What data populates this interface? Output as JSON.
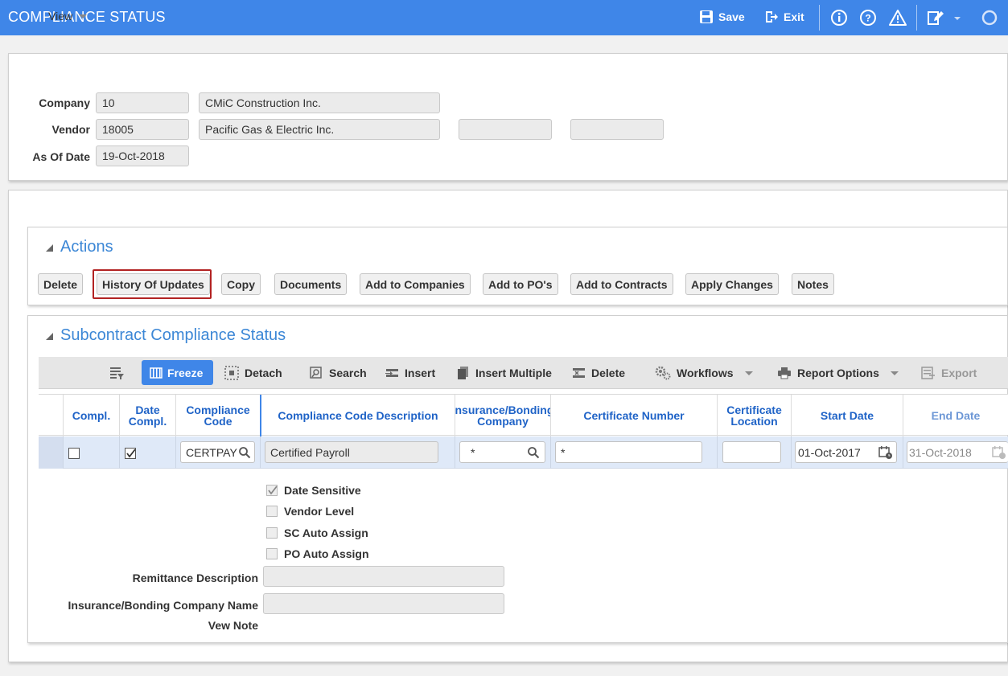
{
  "window": {
    "title": "COMPLIANCE STATUS"
  },
  "titlebar": {
    "save_label": "Save",
    "exit_label": "Exit"
  },
  "header": {
    "company_label": "Company",
    "company_code": "10",
    "company_name": "CMiC Construction Inc.",
    "vendor_label": "Vendor",
    "vendor_code": "18005",
    "vendor_name": "Pacific Gas & Electric Inc.",
    "vendor_extra1": "",
    "vendor_extra2": "",
    "as_of_date_label": "As Of Date",
    "as_of_date": "19-Oct-2018"
  },
  "actions": {
    "title": "Actions",
    "buttons": [
      "Delete",
      "History Of Updates",
      "Copy",
      "Documents",
      "Add to Companies",
      "Add to PO's",
      "Add to Contracts",
      "Apply Changes",
      "Notes"
    ],
    "highlighted": "History Of Updates"
  },
  "compliance": {
    "title": "Subcontract Compliance Status",
    "toolbar": {
      "view": "View",
      "freeze": "Freeze",
      "detach": "Detach",
      "search": "Search",
      "insert": "Insert",
      "insert_multiple": "Insert Multiple",
      "delete": "Delete",
      "workflows": "Workflows",
      "report_options": "Report Options",
      "export": "Export"
    },
    "columns": {
      "compl": "Compl.",
      "date_compl_1": "Date",
      "date_compl_2": "Compl.",
      "code_1": "Compliance",
      "code_2": "Code",
      "description": "Compliance Code Description",
      "insurance_1": "Insurance/Bonding",
      "insurance_2": "Company",
      "certificate_number": "Certificate Number",
      "cert_loc_1": "Certificate",
      "cert_loc_2": "Location",
      "start_date": "Start Date",
      "end_date": "End Date"
    },
    "row": {
      "compl": false,
      "date_compl": true,
      "code": "CERTPAY",
      "description": "Certified Payroll",
      "insurance": "*",
      "certificate_number": "*",
      "certificate_location": "",
      "start_date": "01-Oct-2017",
      "end_date": "31-Oct-2018"
    },
    "detail": {
      "date_sensitive_label": "Date Sensitive",
      "date_sensitive": true,
      "vendor_level_label": "Vendor Level",
      "vendor_level": false,
      "sc_auto_assign_label": "SC Auto Assign",
      "sc_auto_assign": false,
      "po_auto_assign_label": "PO Auto Assign",
      "po_auto_assign": false,
      "remittance_label": "Remittance Description",
      "remittance": "",
      "ins_bond_name_label": "Insurance/Bonding Company Name",
      "ins_bond_name": "",
      "vew_note_label": "Vew Note"
    }
  },
  "colors": {
    "accent": "#3f86e8",
    "section_title": "#3c87d6",
    "column_header": "#1f63c7",
    "row_selected": "#dfe9f8",
    "highlight_border": "#b22222"
  }
}
